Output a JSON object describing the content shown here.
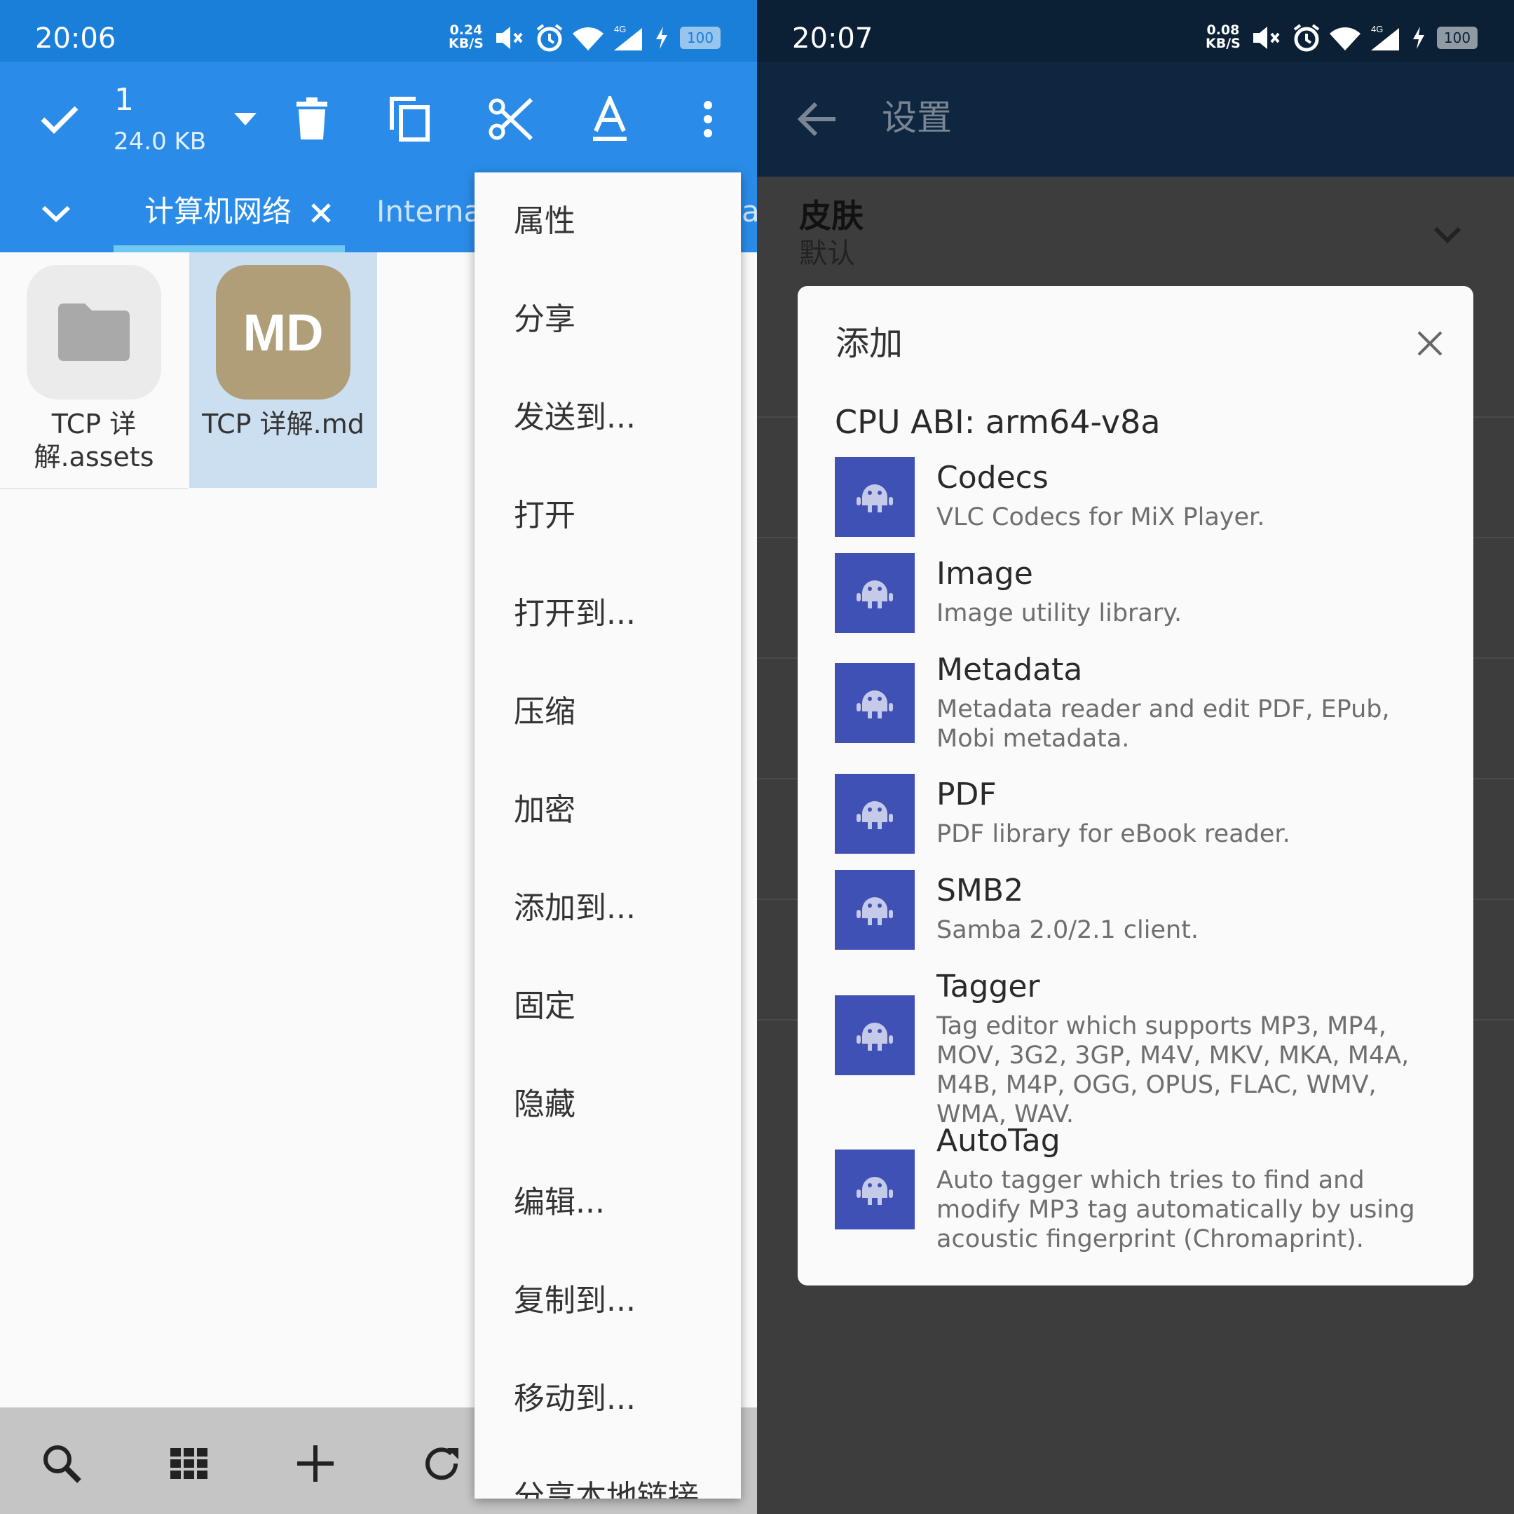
{
  "left": {
    "status": {
      "time": "20:06",
      "speed_value": "0.24",
      "speed_unit": "KB/S",
      "network": "4G",
      "battery": "100"
    },
    "selection": {
      "count": "1",
      "size": "24.0 KB"
    },
    "toolbar_icons": [
      "check-icon",
      "dropdown-icon",
      "delete-icon",
      "copy-icon",
      "cut-icon",
      "rename-icon",
      "more-icon"
    ],
    "tabs": [
      {
        "label": "计算机网络",
        "active": true
      },
      {
        "label": "Internal",
        "active": false
      },
      {
        "label": "a",
        "active": false
      }
    ],
    "files": [
      {
        "name": "TCP 详解.assets",
        "icon": "folder-icon",
        "selected": false
      },
      {
        "name": "TCP 详解.md",
        "icon_text": "MD",
        "selected": true
      }
    ],
    "menu": [
      "属性",
      "分享",
      "发送到...",
      "打开",
      "打开到...",
      "压缩",
      "加密",
      "添加到...",
      "固定",
      "隐藏",
      "编辑...",
      "复制到...",
      "移动到...",
      "分享本地链接"
    ],
    "bottom_icons": [
      "search-icon",
      "grid-icon",
      "add-icon",
      "refresh-icon"
    ],
    "colors": {
      "status": "#1a7fd9",
      "toolbar": "#2a8ce8",
      "md_icon": "#b09e78",
      "selected_bg": "#ccdff0"
    }
  },
  "right": {
    "status": {
      "time": "20:07",
      "speed_value": "0.08",
      "speed_unit": "KB/S",
      "network": "4G",
      "battery": "100"
    },
    "appbar_title": "设置",
    "settings_item": {
      "title": "皮肤",
      "value": "默认"
    },
    "dialog": {
      "title": "添加",
      "abi": "CPU ABI: arm64-v8a",
      "plugins": [
        {
          "name": "Codecs",
          "desc": "VLC Codecs for MiX Player."
        },
        {
          "name": "Image",
          "desc": "Image utility library."
        },
        {
          "name": "Metadata",
          "desc": "Metadata reader and edit PDF, EPub, Mobi metadata."
        },
        {
          "name": "PDF",
          "desc": "PDF library for eBook reader."
        },
        {
          "name": "SMB2",
          "desc": "Samba 2.0/2.1 client."
        },
        {
          "name": "Tagger",
          "desc": "Tag editor which supports MP3, MP4, MOV, 3G2, 3GP, M4V, MKV, MKA, M4A, M4B, M4P, OGG, OPUS, FLAC, WMV, WMA, WAV."
        },
        {
          "name": "AutoTag",
          "desc": "Auto tagger which tries to find and modify MP3 tag automatically by using acoustic fingerprint (Chromaprint)."
        }
      ]
    },
    "colors": {
      "status": "#0b1f35",
      "appbar": "#0f2640",
      "plugin_icon": "#3f51b5"
    }
  }
}
